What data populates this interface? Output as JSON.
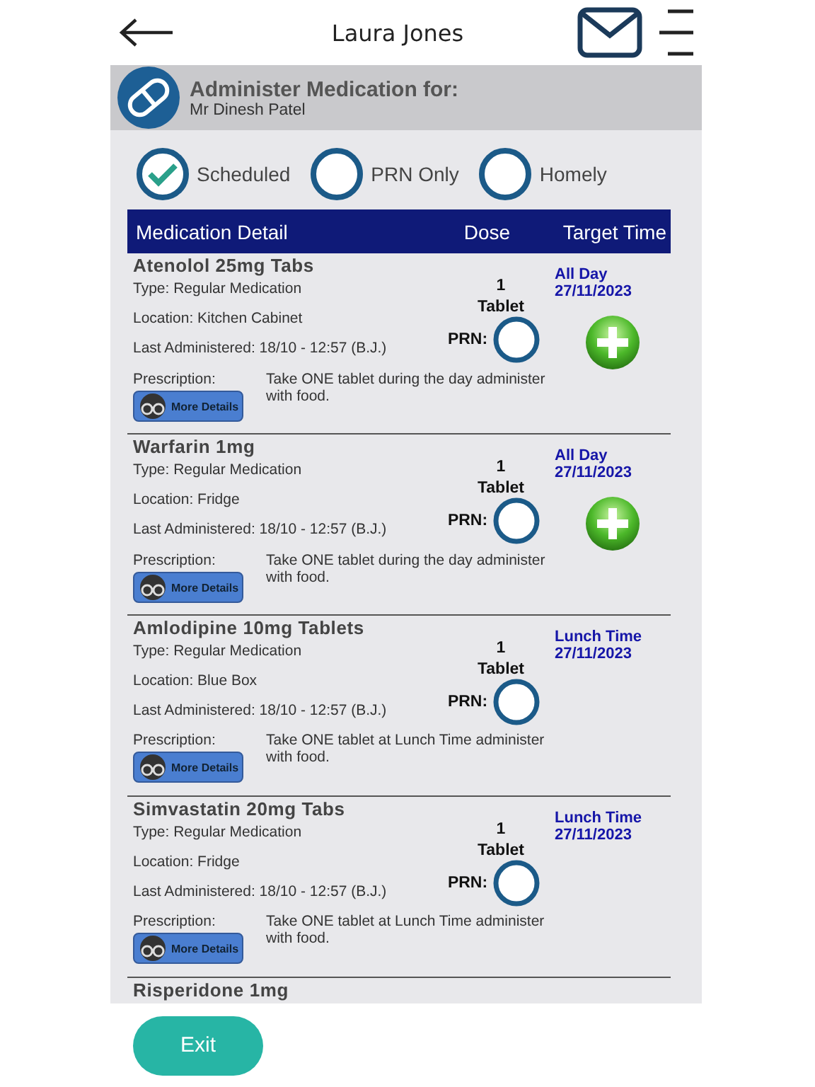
{
  "header": {
    "title": "Laura Jones"
  },
  "banner": {
    "heading": "Administer Medication for:",
    "patient": "Mr Dinesh Patel"
  },
  "filters": [
    {
      "label": "Scheduled",
      "selected": true
    },
    {
      "label": "PRN Only",
      "selected": false
    },
    {
      "label": "Homely",
      "selected": false
    }
  ],
  "table": {
    "columns": [
      "Medication Detail",
      "Dose",
      "Target Time"
    ],
    "rows": [
      {
        "name": "Atenolol 25mg Tabs",
        "type": "Type: Regular Medication",
        "location": "Location: Kitchen Cabinet",
        "last": "Last Administered: 18/10 - 12:57 (B.J.)",
        "dose_amount": "1",
        "dose_unit": "Tablet",
        "prn_label": "PRN:",
        "prn_checked": false,
        "target": "All Day",
        "date": "27/11/2023",
        "add_button": true,
        "prescription_label": "Prescription:",
        "prescription": "Take ONE tablet during the day administer with food.",
        "details_button": "More Details"
      },
      {
        "name": "Warfarin 1mg",
        "type": "Type: Regular Medication",
        "location": "Location: Fridge",
        "last": "Last Administered: 18/10 - 12:57 (B.J.)",
        "dose_amount": "1",
        "dose_unit": "Tablet",
        "prn_label": "PRN:",
        "prn_checked": false,
        "target": "All Day",
        "date": "27/11/2023",
        "add_button": true,
        "prescription_label": "Prescription:",
        "prescription": "Take ONE tablet during the day administer with food.",
        "details_button": "More Details"
      },
      {
        "name": "Amlodipine 10mg Tablets",
        "type": "Type: Regular Medication",
        "location": "Location: Blue Box",
        "last": "Last Administered: 18/10 - 12:57 (B.J.)",
        "dose_amount": "1",
        "dose_unit": "Tablet",
        "prn_label": "PRN:",
        "prn_checked": false,
        "target": "Lunch Time",
        "date": "27/11/2023",
        "add_button": false,
        "prescription_label": "Prescription:",
        "prescription": "Take ONE tablet at Lunch Time administer with food.",
        "details_button": "More Details"
      },
      {
        "name": "Simvastatin 20mg Tabs",
        "type": "Type: Regular Medication",
        "location": "Location: Fridge",
        "last": "Last Administered: 18/10 - 12:57 (B.J.)",
        "dose_amount": "1",
        "dose_unit": "Tablet",
        "prn_label": "PRN:",
        "prn_checked": false,
        "target": "Lunch Time",
        "date": "27/11/2023",
        "add_button": false,
        "prescription_label": "Prescription:",
        "prescription": "Take ONE tablet at Lunch Time administer with food.",
        "details_button": "More Details"
      },
      {
        "name": "Risperidone 1mg"
      }
    ]
  },
  "footer": {
    "exit_button": "Exit"
  }
}
